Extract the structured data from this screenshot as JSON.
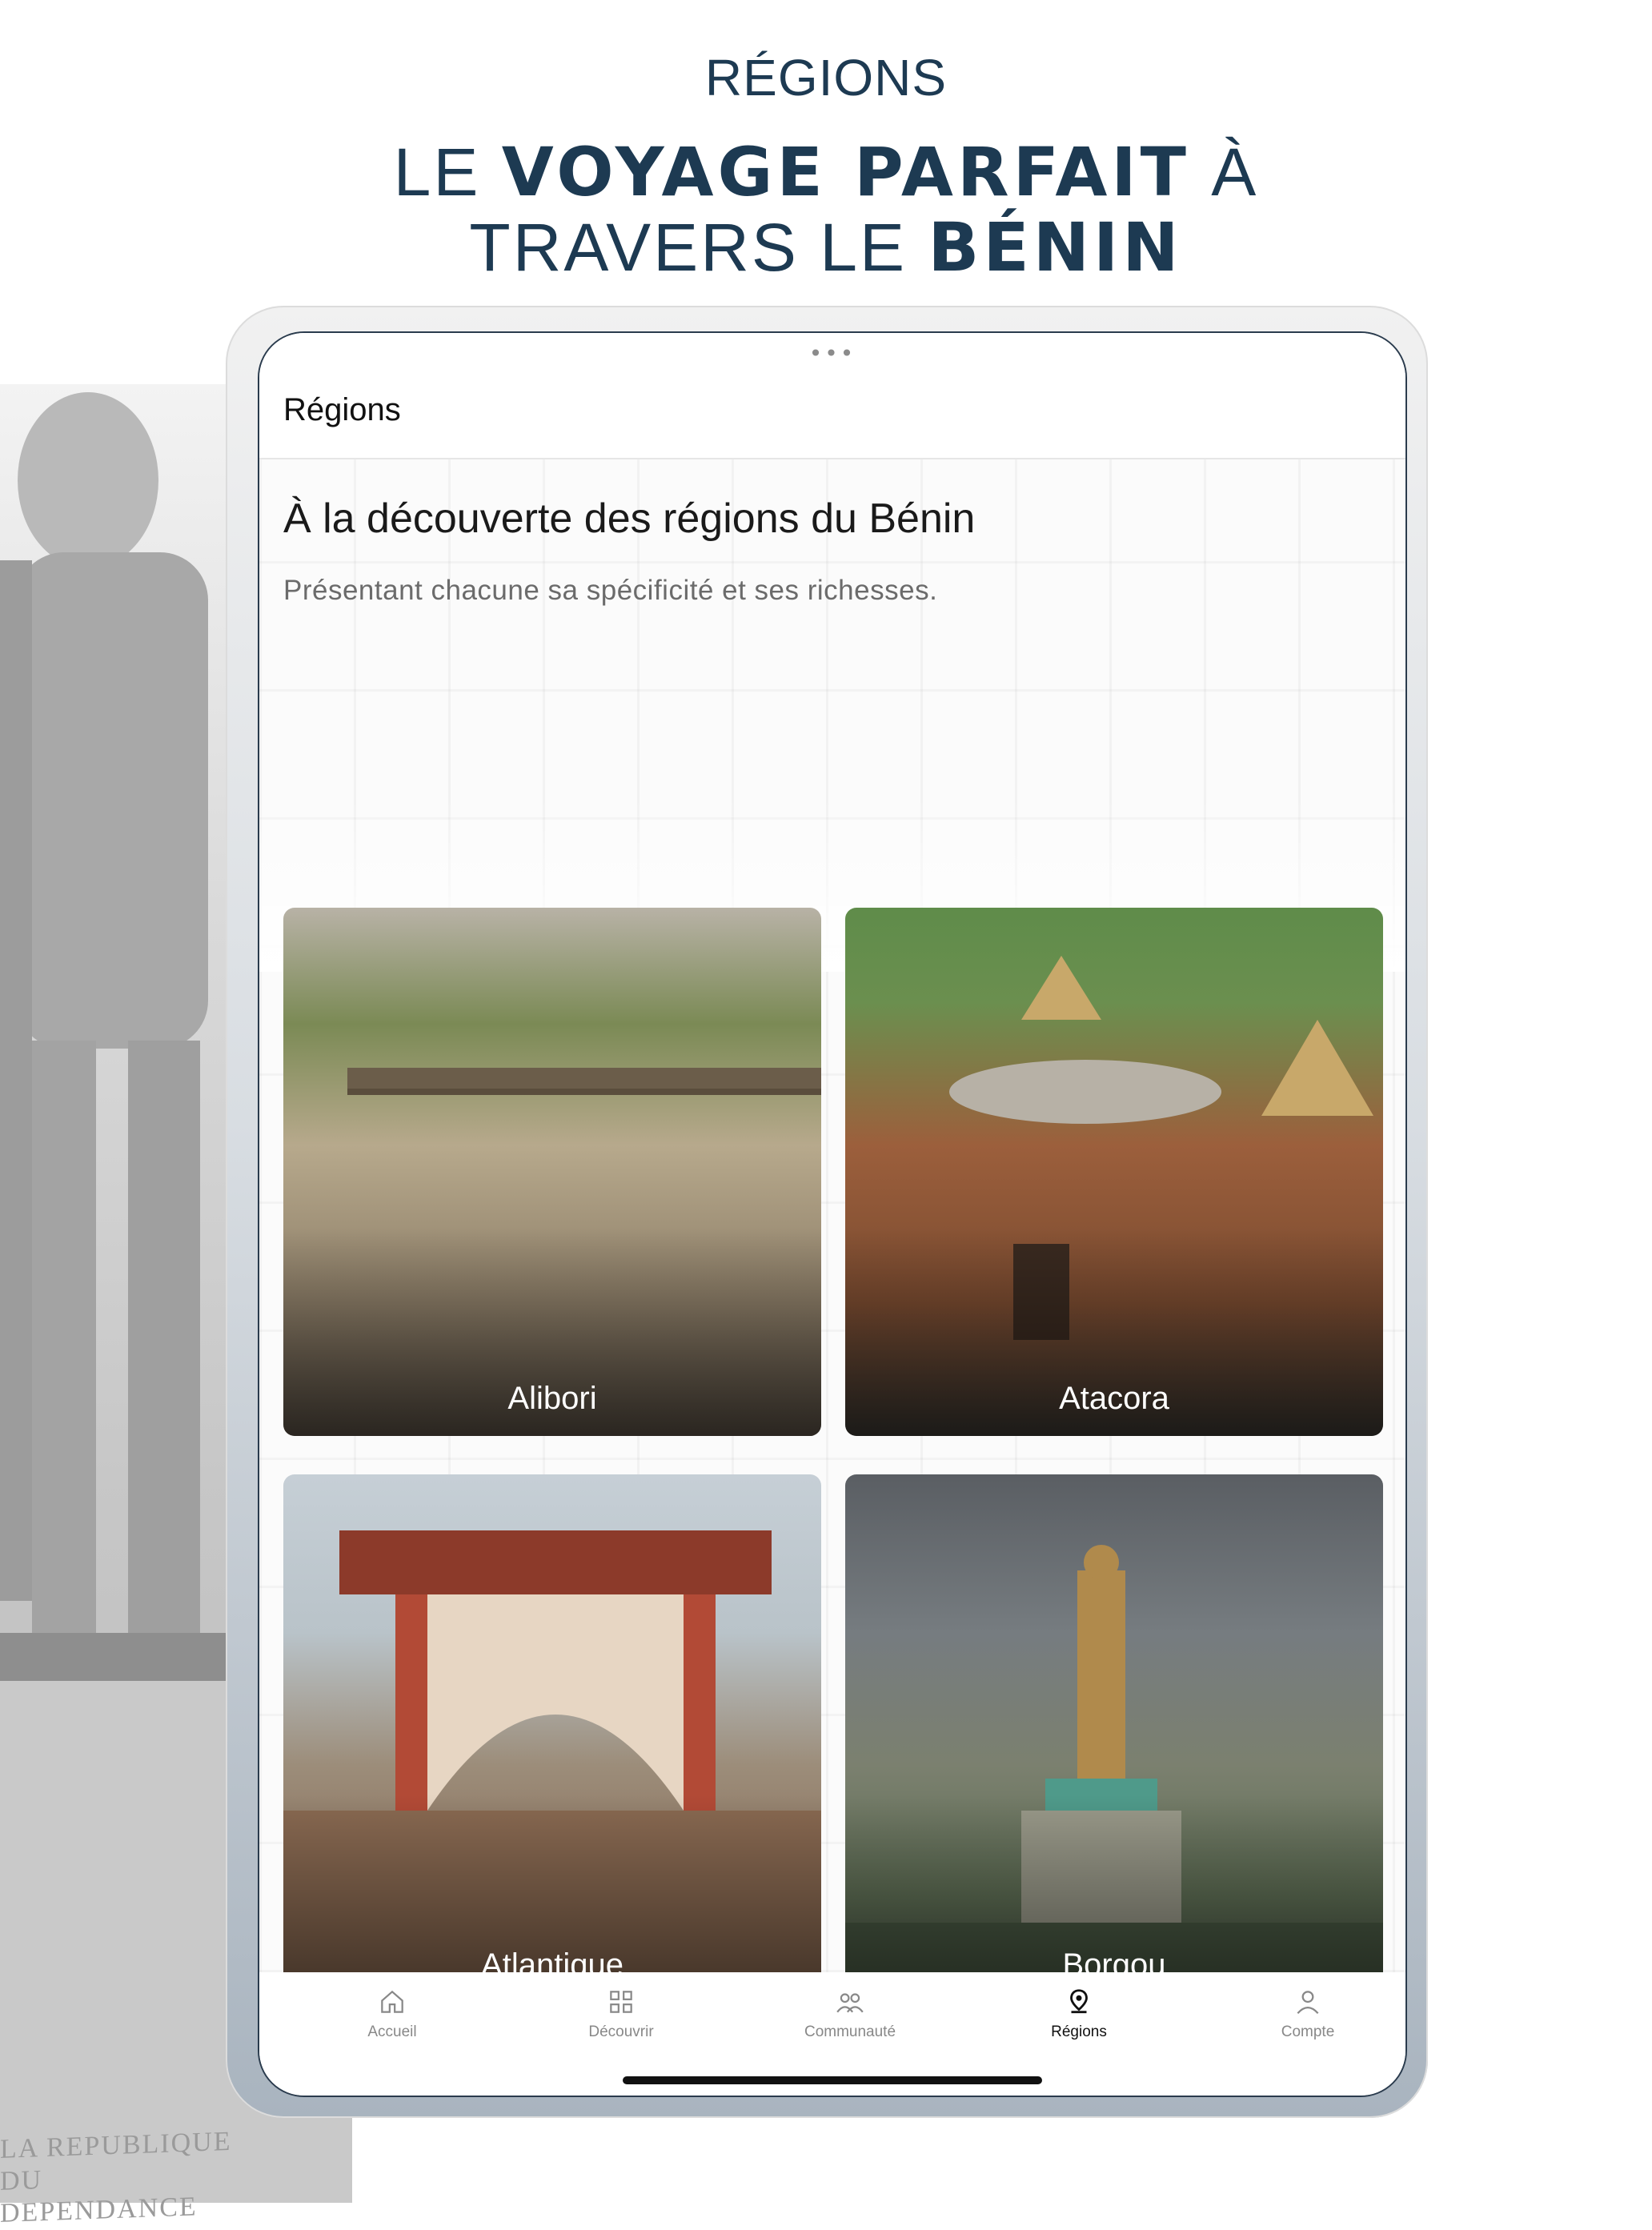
{
  "promo": {
    "kicker": "RÉGIONS",
    "title_line1_pre": "LE ",
    "title_line1_bold": "VOYAGE PARFAIT",
    "title_line1_post": " À",
    "title_line2_pre": "TRAVERS LE ",
    "title_line2_bold": "BÉNIN"
  },
  "background": {
    "plaque_line1": "LA REPUBLIQUE DU",
    "plaque_line2": "DEPENDANCE"
  },
  "app": {
    "more_dots": "•••",
    "header_title": "Régions",
    "section_title": "À la découverte des régions du Bénin",
    "section_subtitle": "Présentant chacune sa spécificité et ses richesses.",
    "regions": [
      {
        "name": "Alibori"
      },
      {
        "name": "Atacora"
      },
      {
        "name": "Atlantique"
      },
      {
        "name": "Borgou"
      }
    ],
    "tabs": [
      {
        "label": "Accueil",
        "icon": "home-icon",
        "active": false
      },
      {
        "label": "Découvrir",
        "icon": "grid-icon",
        "active": false
      },
      {
        "label": "Communauté",
        "icon": "community-icon",
        "active": false
      },
      {
        "label": "Régions",
        "icon": "location-pin-icon",
        "active": true
      },
      {
        "label": "Compte",
        "icon": "user-icon",
        "active": false
      }
    ]
  },
  "colors": {
    "heading_navy": "#1d3a52",
    "active_tab": "#111111",
    "inactive_tab": "#888888"
  }
}
